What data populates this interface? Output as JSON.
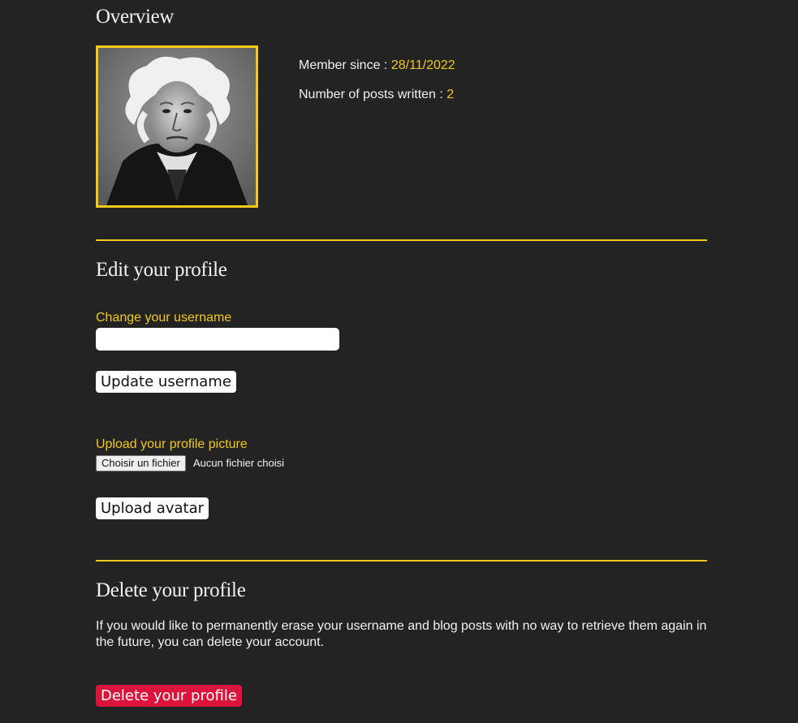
{
  "overview": {
    "heading": "Overview",
    "member_since_label": "Member since : ",
    "member_since_value": "28/11/2022",
    "posts_label": "Number of posts written : ",
    "posts_value": "2"
  },
  "edit": {
    "heading": "Edit your profile",
    "username_label": "Change your username",
    "username_value": "",
    "update_username_button": "Update username",
    "upload_label": "Upload your profile picture",
    "choose_file_button": "Choisir un fichier",
    "file_status": "Aucun fichier choisi",
    "upload_avatar_button": "Upload avatar"
  },
  "delete": {
    "heading": "Delete your profile",
    "description": "If you would like to permanently erase your username and blog posts with no way to retrieve them again in the future, you can delete your account.",
    "delete_button": "Delete your profile"
  },
  "colors": {
    "background": "#232323",
    "accent": "#f2c81a",
    "danger": "#dc143c",
    "text": "#f1f1f1"
  }
}
